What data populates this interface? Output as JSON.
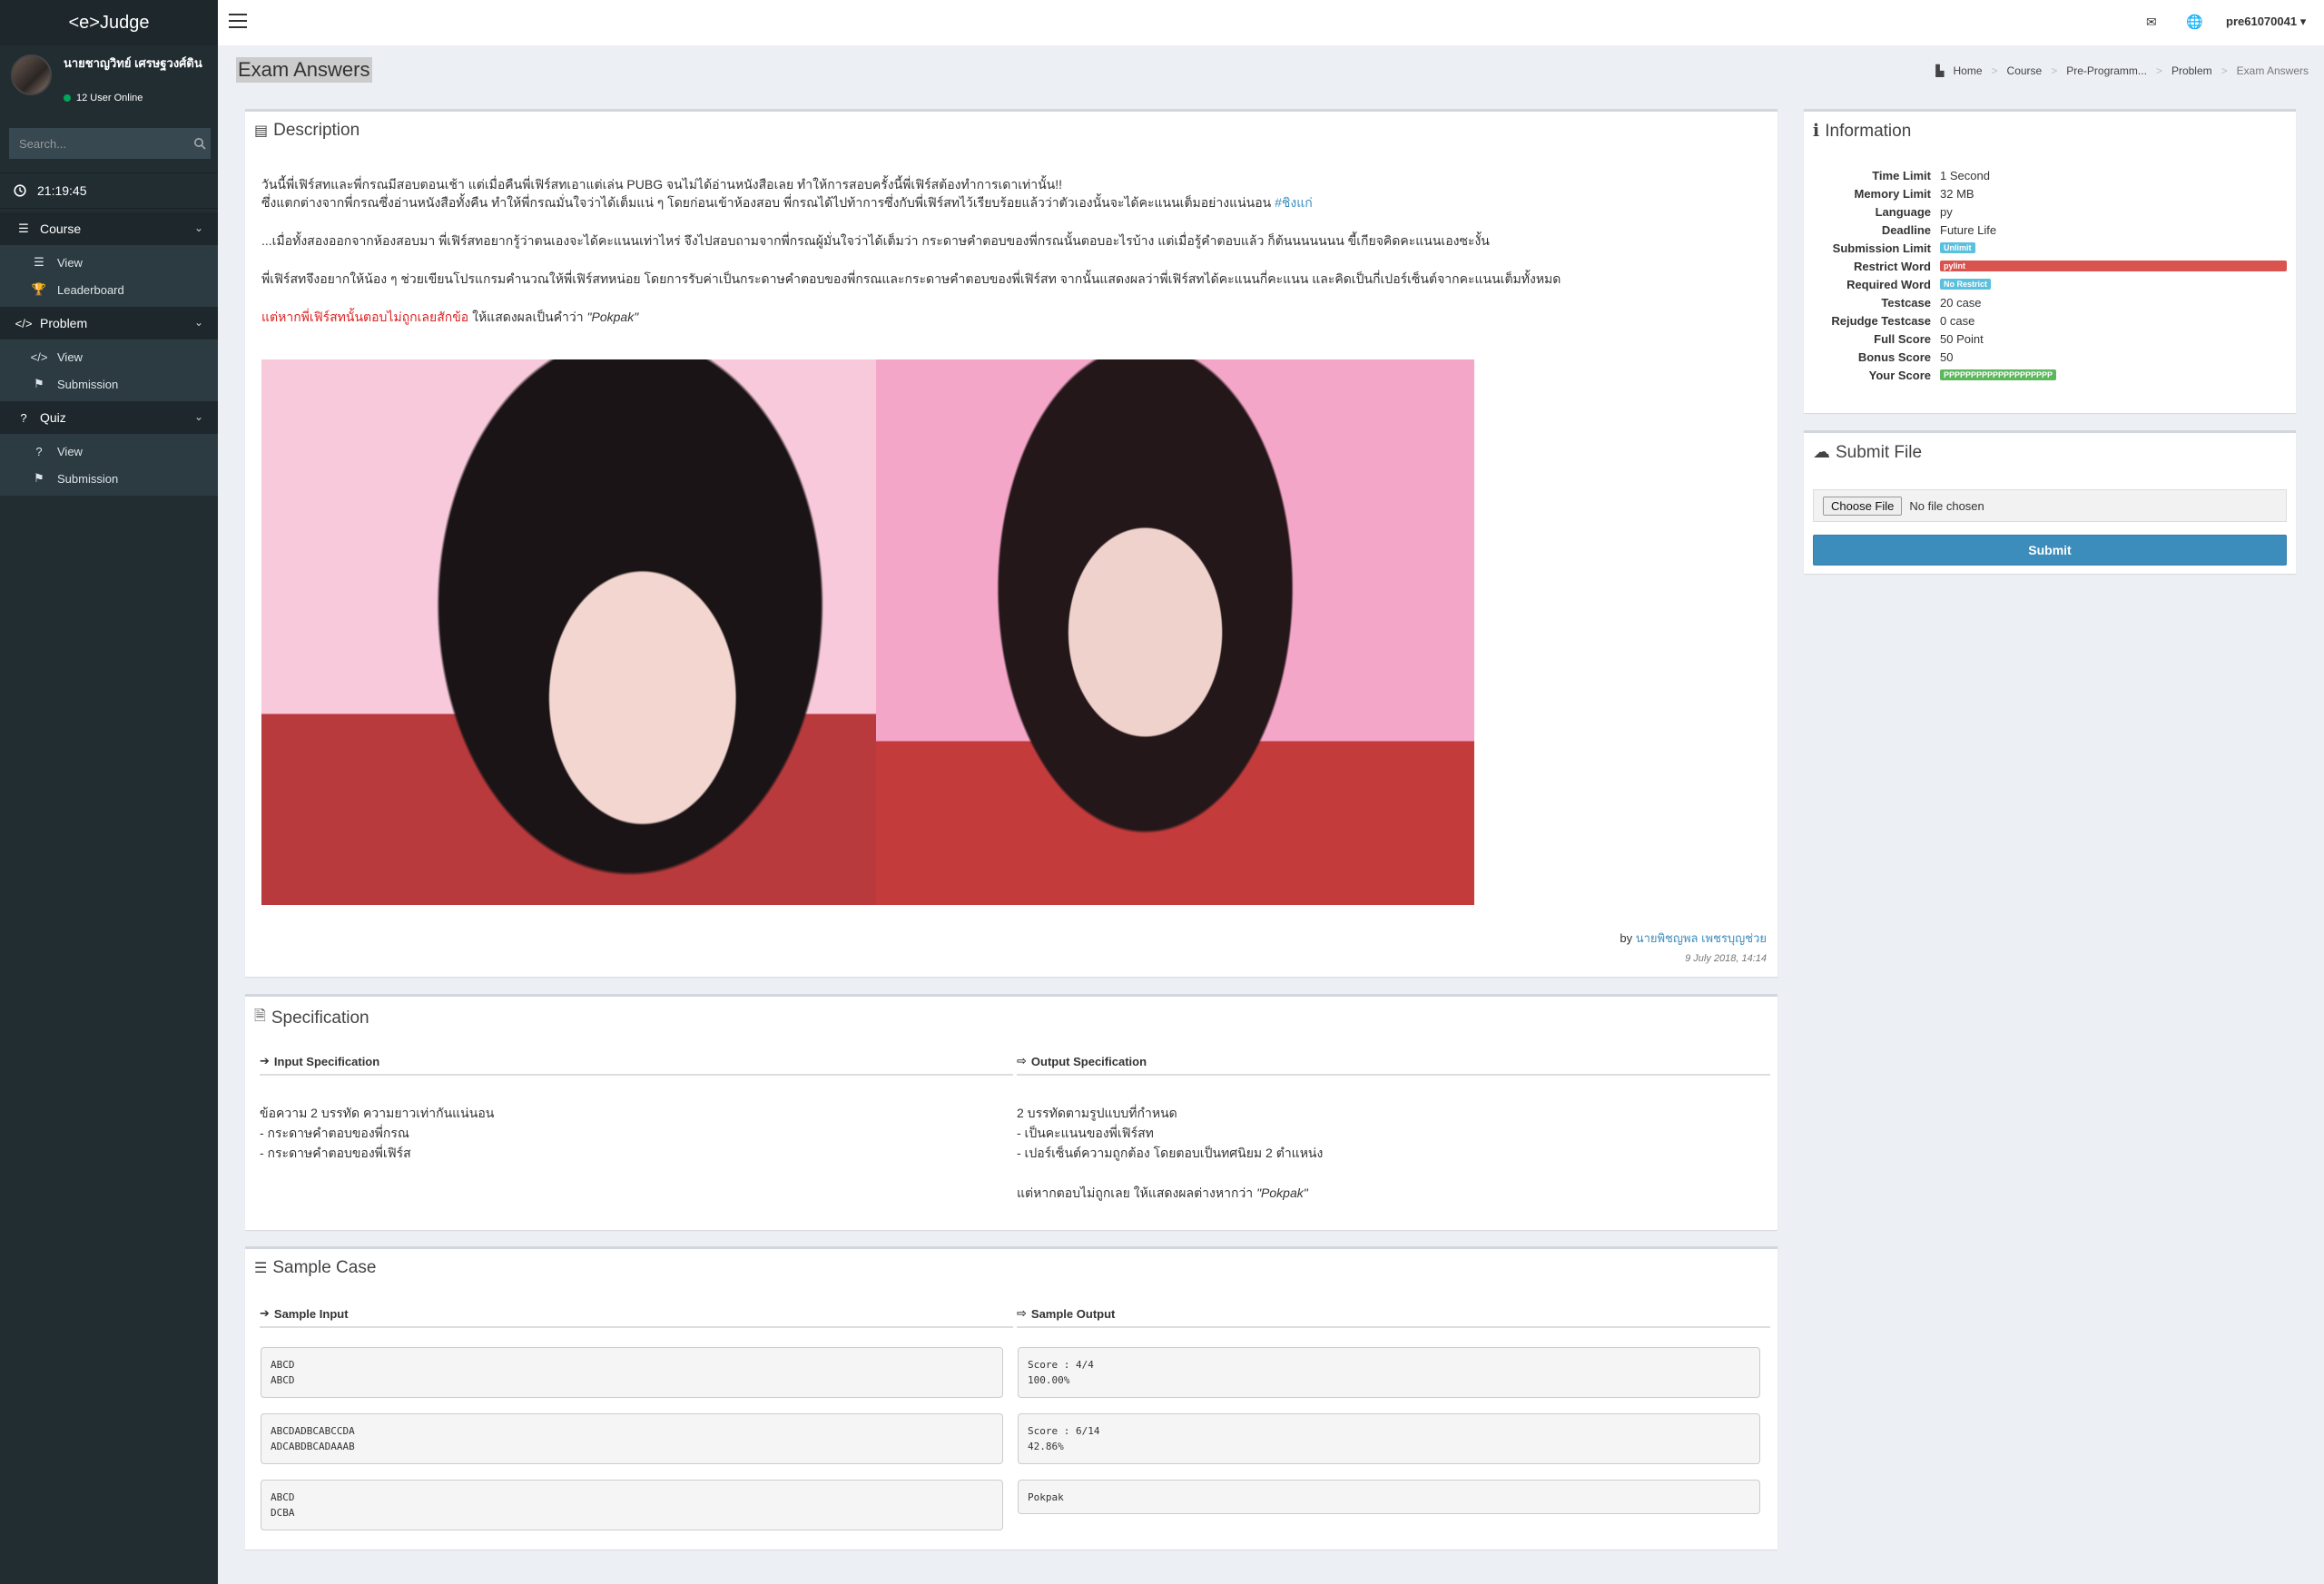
{
  "app": {
    "logo": "<e>Judge"
  },
  "user": {
    "name": "นายชาญวิทย์ เศรษฐวงศ์ดิน",
    "online": "12 User Online"
  },
  "sidebar": {
    "search_placeholder": "Search...",
    "clock": "21:19:45",
    "sections": [
      {
        "label": "Course",
        "items": [
          {
            "label": "View"
          },
          {
            "label": "Leaderboard"
          }
        ]
      },
      {
        "label": "Problem",
        "items": [
          {
            "label": "View"
          },
          {
            "label": "Submission"
          }
        ]
      },
      {
        "label": "Quiz",
        "items": [
          {
            "label": "View"
          },
          {
            "label": "Submission"
          }
        ]
      }
    ]
  },
  "topbar": {
    "username": "pre61070041"
  },
  "page": {
    "title": "Exam Answers"
  },
  "breadcrumb": [
    "Home",
    "Course",
    "Pre-Programm...",
    "Problem",
    "Exam Answers"
  ],
  "description": {
    "title": "Description",
    "p1a": "วันนี้พี่เฟิร์สทและพี่กรณมีสอบตอนเช้า แต่เมื่อคืนพี่เฟิร์สทเอาแต่เล่น PUBG จนไม่ได้อ่านหนังสือเลย ทำให้การสอบครั้งนี้พี่เฟิร์สต้องทำการเดาเท่านั้น!!",
    "p1b": "ซึ่งแตกต่างจากพี่กรณซึ่งอ่านหนังสือทั้งคืน ทำให้พี่กรณมั่นใจว่าได้เต็มแน่ ๆ โดยก่อนเข้าห้องสอบ พี่กรณได้ไปท้าการซึ่งกับพี่เฟิร์สทไว้เรียบร้อยแล้วว่าตัวเองนั้นจะได้คะแนนเต็มอย่างแน่นอน",
    "hashtag": "#ชิงแก่",
    "p2": "...เมื่อทั้งสองออกจากห้องสอบมา พี่เฟิร์สทอยากรู้ว่าตนเองจะได้คะแนนเท่าไหร่ จึงไปสอบถามจากพี่กรณผู้มั่นใจว่าได้เต็มว่า กระดาษคำตอบของพี่กรณนั้นตอบอะไรบ้าง แต่เมื่อรู้คำตอบแล้ว ก็ต้นนนนนนน ขี้เกียจคิดคะแนนเองซะงั้น",
    "p3": "พี่เฟิร์สทจึงอยากให้น้อง ๆ ช่วยเขียนโปรแกรมคำนวณให้พี่เฟิร์สทหน่อย โดยการรับค่าเป็นกระดาษคำตอบของพี่กรณและกระดาษคำตอบของพี่เฟิร์สท จากนั้นแสดงผลว่าพี่เฟิร์สทได้คะแนนกี่คะแนน และคิดเป็นกี่เปอร์เซ็นต์จากคะแนนเต็มทั้งหมด",
    "p4_red": "แต่หากพี่เฟิร์สทนั้นตอบไม่ถูกเลยสักข้อ",
    "p4_rest": " ให้แสดงผลเป็นคำว่า ",
    "p4_quote": "\"Pokpak\"",
    "by_prefix": "by ",
    "author": "นายพิชญพล เพชรบุญช่วย",
    "date": "9 July 2018, 14:14"
  },
  "specification": {
    "title": "Specification",
    "input_title": "Input Specification",
    "input_lines": [
      "ข้อความ 2 บรรทัด ความยาวเท่ากันแน่นอน",
      "- กระดาษคำตอบของพี่กรณ",
      "- กระดาษคำตอบของพี่เฟิร์ส"
    ],
    "output_title": "Output Specification",
    "output_lines": [
      "2 บรรทัดตามรูปแบบที่กำหนด",
      "- เป็นคะแนนของพี่เฟิร์สท",
      "- เปอร์เซ็นต์ความถูกต้อง โดยตอบเป็นทศนิยม 2 ตำแหน่ง"
    ],
    "output_extra": "แต่หากตอบไม่ถูกเลย ให้แสดงผลต่างหากว่า ",
    "output_quote": "\"Pokpak\""
  },
  "sample": {
    "title": "Sample Case",
    "input_title": "Sample Input",
    "output_title": "Sample Output",
    "cases": [
      {
        "input": "ABCD\nABCD",
        "output": "Score : 4/4\n100.00%"
      },
      {
        "input": "ABCDADBCABCCDA\nADCABDBCADAAAB",
        "output": "Score : 6/14\n42.86%"
      },
      {
        "input": "ABCD\nDCBA",
        "output": "Pokpak"
      }
    ]
  },
  "information": {
    "title": "Information",
    "rows": [
      {
        "k": "Time Limit",
        "v": "1 Second"
      },
      {
        "k": "Memory Limit",
        "v": "32 MB"
      },
      {
        "k": "Language",
        "v": "py"
      },
      {
        "k": "Deadline",
        "v": "Future Life"
      },
      {
        "k": "Submission Limit",
        "v": "Unlimit"
      },
      {
        "k": "Restrict Word",
        "v": "pylint"
      },
      {
        "k": "Required Word",
        "v": "No Restrict"
      },
      {
        "k": "Testcase",
        "v": "20 case"
      },
      {
        "k": "Rejudge Testcase",
        "v": "0 case"
      },
      {
        "k": "Full Score",
        "v": "50 Point"
      },
      {
        "k": "Bonus Score",
        "v": "50"
      },
      {
        "k": "Your Score",
        "v": "PPPPPPPPPPPPPPPPPPPP"
      }
    ]
  },
  "submit": {
    "title": "Submit File",
    "choose_label": "Choose File",
    "no_file": "No file chosen",
    "button": "Submit"
  },
  "colors": {
    "sidebar": "#222d32",
    "primary": "#3c8dbc",
    "danger": "#d9534f",
    "success": "#5cb85c",
    "info": "#5bc0de"
  }
}
